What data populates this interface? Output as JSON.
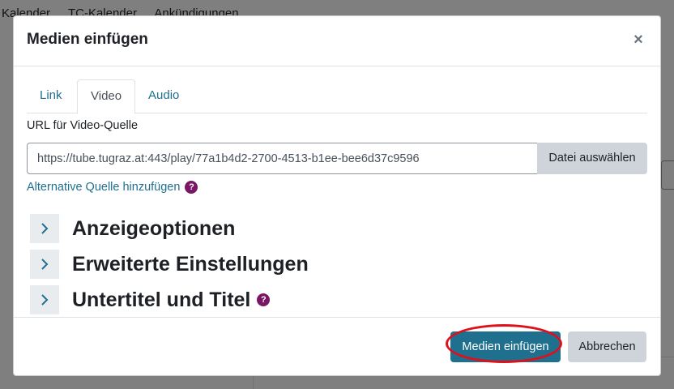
{
  "background": {
    "nav_items": [
      "Kalender",
      "TC-Kalender",
      "Ankündigungen"
    ]
  },
  "modal": {
    "title": "Medien einfügen",
    "close_label": "×",
    "tabs": [
      {
        "label": "Link",
        "active": false
      },
      {
        "label": "Video",
        "active": true
      },
      {
        "label": "Audio",
        "active": false
      }
    ],
    "url_label": "URL für Video-Quelle",
    "url_value": "https://tube.tugraz.at:443/play/77a1b4d2-2700-4513-b1ee-bee6d37c9596",
    "file_button": "Datei auswählen",
    "alt_source_link": "Alternative Quelle hinzufügen",
    "help_glyph": "?",
    "sections": [
      {
        "label": "Anzeigeoptionen",
        "has_help": false
      },
      {
        "label": "Erweiterte Einstellungen",
        "has_help": false
      },
      {
        "label": "Untertitel und Titel",
        "has_help": true
      }
    ],
    "footer": {
      "insert_button": "Medien einfügen",
      "cancel_button": "Abbrechen"
    }
  },
  "colors": {
    "accent": "#1f6f8f",
    "help_icon": "#7a1764",
    "annotation_ring": "#e0101a"
  },
  "icons": {
    "close": "close-icon",
    "help": "help-icon",
    "section_toggle": "chevron-right-icon"
  }
}
